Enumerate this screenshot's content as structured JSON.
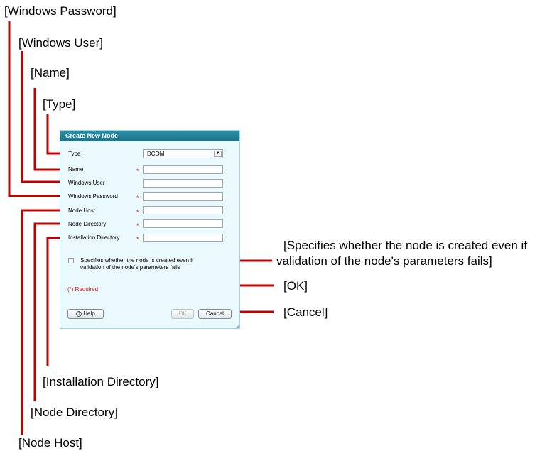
{
  "callouts": {
    "windows_password": "[Windows Password]",
    "windows_user": "[Windows User]",
    "name": "[Name]",
    "type": "[Type]",
    "specifies_line1": "[Specifies whether the node is created even if",
    "specifies_line2": "validation of the node's parameters fails]",
    "ok": "[OK]",
    "cancel": "[Cancel]",
    "installation_directory": "[Installation Directory]",
    "node_directory": "[Node Directory]",
    "node_host": "[Node Host]"
  },
  "dialog": {
    "title": "Create New Node",
    "labels": {
      "type": "Type",
      "name": "Name",
      "windows_user": "Windows User",
      "windows_password": "Windows Password",
      "node_host": "Node Host",
      "node_directory": "Node Directory",
      "installation_directory": "Installation Directory"
    },
    "required_mark": "*",
    "type_value": "DCOM",
    "dropdown_arrow": "▼",
    "checkbox_line1": "Specifies whether the node is created even if",
    "checkbox_line2": "validation of the node's parameters fails",
    "required_note": "(*) Required",
    "help_label": "Help",
    "help_icon_glyph": "?",
    "ok_label": "OK",
    "cancel_label": "Cancel"
  },
  "colors": {
    "leader": "#c00000",
    "title_bar": "#1e7389",
    "dialog_bg": "#eaf9fd",
    "required": "#d02020"
  }
}
